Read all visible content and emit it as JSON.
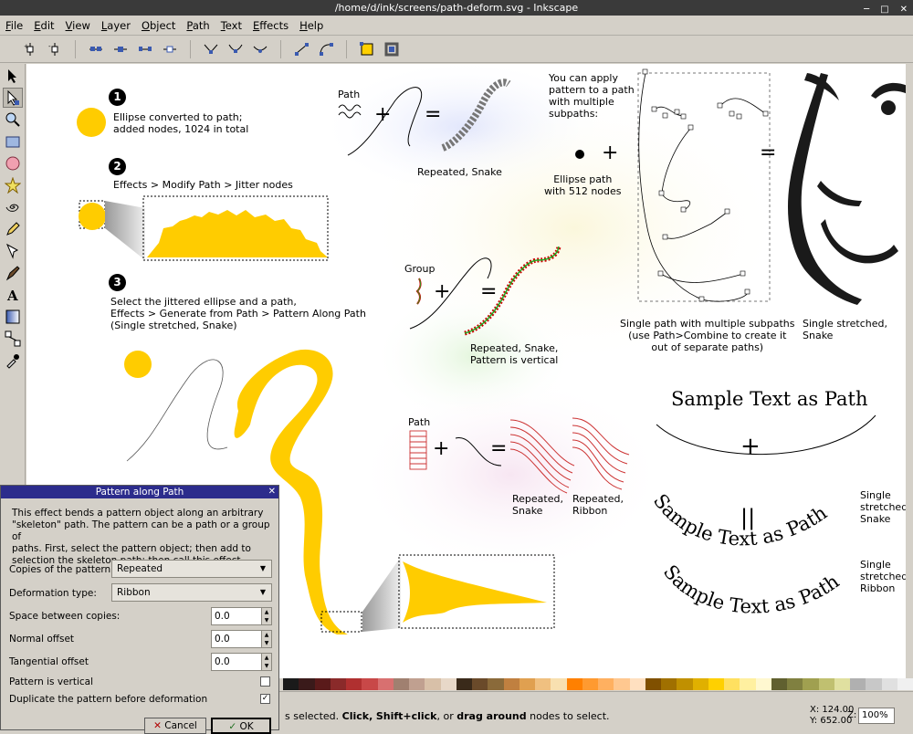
{
  "window": {
    "title": "/home/d/ink/screens/path-deform.svg - Inkscape"
  },
  "menu": [
    "File",
    "Edit",
    "View",
    "Layer",
    "Object",
    "Path",
    "Text",
    "Effects",
    "Help"
  ],
  "toolbar_icons": [
    "add-node-icon",
    "delete-node-icon",
    "join-nodes-icon",
    "break-path-icon",
    "join-segment-icon",
    "delete-segment-icon",
    "cusp-node-icon",
    "smooth-node-icon",
    "symmetric-node-icon",
    "line-segment-icon",
    "curve-segment-icon",
    "object-to-path-icon",
    "stroke-to-path-icon"
  ],
  "tools": [
    "selector-icon",
    "node-editor-icon",
    "zoom-icon",
    "rectangle-icon",
    "ellipse-icon",
    "star-icon",
    "spiral-icon",
    "pencil-icon",
    "pen-icon",
    "calligraphy-icon",
    "text-icon",
    "gradient-icon",
    "connector-icon",
    "dropper-icon"
  ],
  "canvas": {
    "step1_num": "1",
    "step1_text": "Ellipse converted to path;\nadded nodes, 1024 in total",
    "step2_num": "2",
    "step2_text": "Effects > Modify Path > Jitter nodes",
    "step3_num": "3",
    "step3_text": "Select the jittered ellipse and a path,\nEffects > Generate from Path > Pattern Along Path\n(Single stretched, Snake)",
    "path_label_1": "Path",
    "repeated_snake_1": "Repeated, Snake",
    "group_label": "Group",
    "repeated_snake_vertical": "Repeated, Snake,\nPattern is vertical",
    "path_label_2": "Path",
    "repeated_snake_2": "Repeated,\nSnake",
    "repeated_ribbon": "Repeated,\nRibbon",
    "apply_text": "You can apply\npattern to a path\nwith multiple\nsubpaths:",
    "ellipse_path_text": "Ellipse path\nwith 512 nodes",
    "single_path_text": "Single path with multiple subpaths\n(use Path>Combine to create it\nout of separate paths)",
    "single_stretched_snake_face": "Single stretched, Snake",
    "sample_text_title": "Sample Text as Path",
    "sample_text_snake": "Sample Text as Path",
    "sample_text_ribbon": "Sample Text as Path",
    "single_stretched_snake": "Single\nstretched,\nSnake",
    "single_stretched_ribbon": "Single\nstretched,\nRibbon",
    "plus": "+",
    "equals": "=",
    "parallel": "||"
  },
  "dialog": {
    "title": "Pattern along Path",
    "description": "This effect bends a pattern object along an arbitrary\n\"skeleton\" path. The pattern can be a path or a group of\npaths. First, select the pattern object; then add to\nselection the skeleton path; then call this effect.",
    "copies_label": "Copies of the pattern:",
    "copies_value": "Repeated",
    "deformation_label": "Deformation type:",
    "deformation_value": "Ribbon",
    "space_label": "Space between copies:",
    "space_value": "0.0",
    "normal_label": "Normal offset",
    "normal_value": "0.0",
    "tangential_label": "Tangential offset",
    "tangential_value": "0.0",
    "vertical_label": "Pattern is vertical",
    "vertical_checked": false,
    "duplicate_label": "Duplicate the pattern before deformation",
    "duplicate_checked": true,
    "cancel_label": "Cancel",
    "ok_label": "OK"
  },
  "status": {
    "message_prefix": "s selected.",
    "click": "Click,",
    "shift_click": "Shift+click",
    "or": ", or",
    "drag_around": "drag around",
    "suffix": "nodes to select.",
    "x": "X: 124.00",
    "y": "Y: 652.00",
    "zoom_label": "Z:",
    "zoom": "100%"
  },
  "palette": [
    "#1a1a1a",
    "#3a1a1a",
    "#5a1a1a",
    "#8a2a2a",
    "#b03030",
    "#c84848",
    "#d87070",
    "#a08070",
    "#c0a090",
    "#d8c0a8",
    "#e8d8c8",
    "#3a2a1a",
    "#6a4a2a",
    "#8a6a3a",
    "#c08040",
    "#e0a050",
    "#f0c080",
    "#f8e0b0",
    "#ff8000",
    "#ff9a30",
    "#ffb060",
    "#ffc890",
    "#ffe0c0",
    "#805000",
    "#a07000",
    "#c09000",
    "#e0b000",
    "#ffd000",
    "#ffe060",
    "#fff0a0",
    "#fff8d0",
    "#606030",
    "#808040",
    "#a0a050",
    "#c0c070",
    "#e0e0a0",
    "#b0b0b0",
    "#c8c8c8",
    "#e0e0e0",
    "#f0f0f0"
  ]
}
